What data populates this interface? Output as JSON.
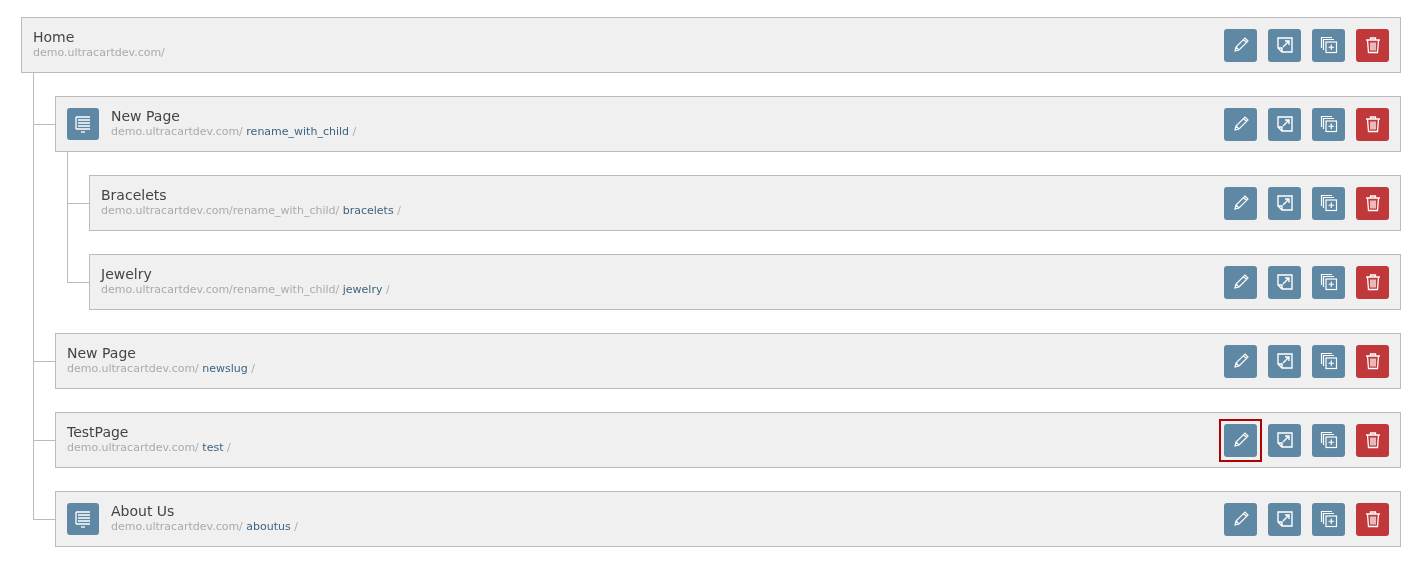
{
  "pages": [
    {
      "title": "Home",
      "base": "demo.ultracartdev.com/",
      "has_icon": false,
      "edit_focused": false,
      "children": [
        {
          "title": "New Page",
          "base": "demo.ultracartdev.com/",
          "slug": "rename_with_child",
          "suffix": "/",
          "has_icon": true,
          "edit_focused": false,
          "children": [
            {
              "title": "Bracelets",
              "base": "demo.ultracartdev.com/rename_with_child/",
              "slug": "bracelets",
              "suffix": "/",
              "has_icon": false,
              "edit_focused": false
            },
            {
              "title": "Jewelry",
              "base": "demo.ultracartdev.com/rename_with_child/",
              "slug": "jewelry",
              "suffix": "/",
              "has_icon": false,
              "edit_focused": false
            }
          ]
        },
        {
          "title": "New Page",
          "base": "demo.ultracartdev.com/",
          "slug": "newslug",
          "suffix": "/",
          "has_icon": false,
          "edit_focused": false
        },
        {
          "title": "TestPage",
          "base": "demo.ultracartdev.com/",
          "slug": "test",
          "suffix": "/",
          "has_icon": false,
          "edit_focused": true
        },
        {
          "title": "About Us",
          "base": "demo.ultracartdev.com/",
          "slug": "aboutus",
          "suffix": "/",
          "has_icon": true,
          "edit_focused": false
        }
      ]
    }
  ]
}
